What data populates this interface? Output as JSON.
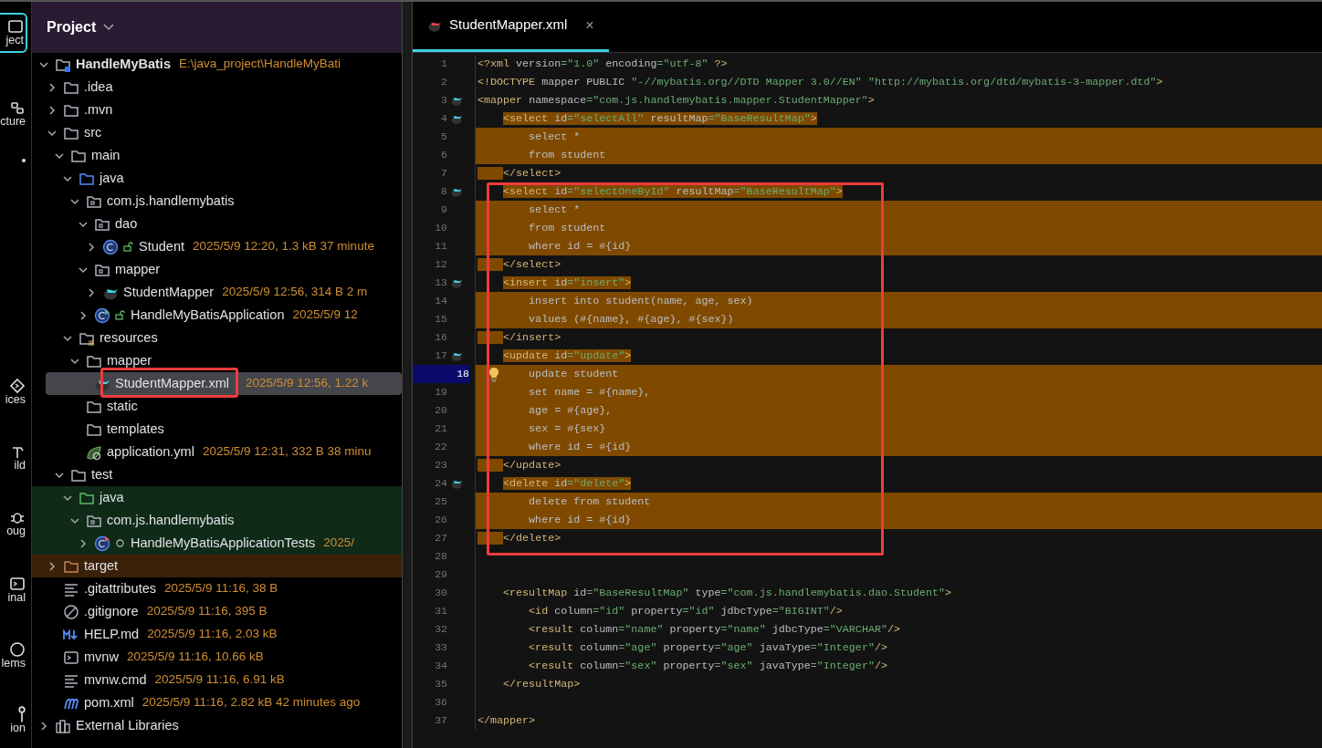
{
  "tool_strip": [
    {
      "label": "ject",
      "kind": "project",
      "selected": true
    },
    {
      "label": "cture",
      "kind": "structure",
      "selected": false
    },
    {
      "kind": "more",
      "selected": false
    },
    {
      "label": "ices",
      "kind": "services",
      "selected": false
    },
    {
      "label": "ild",
      "kind": "build",
      "selected": false
    },
    {
      "label": "oug",
      "kind": "debug",
      "selected": false
    },
    {
      "label": "inal",
      "kind": "terminal",
      "selected": false
    },
    {
      "label": "lems",
      "kind": "problems",
      "selected": false
    },
    {
      "label": "ion",
      "kind": "vcs",
      "selected": false
    }
  ],
  "project_panel": {
    "title": "Project",
    "tree": [
      {
        "name": "HandleMyBatis",
        "path": "E:\\java_project\\HandleMyBati",
        "kind": "module",
        "expanded": true,
        "selected": false,
        "children": [
          {
            "name": ".idea",
            "kind": "folder",
            "expanded": false,
            "selected": false
          },
          {
            "name": ".mvn",
            "kind": "folder",
            "expanded": false,
            "selected": false
          },
          {
            "name": "src",
            "kind": "folder",
            "expanded": true,
            "selected": false,
            "children": [
              {
                "name": "main",
                "kind": "folder",
                "expanded": true,
                "selected": false,
                "children": [
                  {
                    "name": "java",
                    "kind": "source-folder",
                    "expanded": true,
                    "selected": false,
                    "children": [
                      {
                        "name": "com.js.handlemybatis",
                        "kind": "package",
                        "expanded": true,
                        "selected": false,
                        "children": [
                          {
                            "name": "dao",
                            "kind": "package",
                            "expanded": true,
                            "selected": false,
                            "children": [
                              {
                                "name": "Student",
                                "kind": "public-class",
                                "expanded": false,
                                "selected": false,
                                "meta": "2025/5/9 12:20, 1.3 kB 37 minute"
                              }
                            ]
                          },
                          {
                            "name": "mapper",
                            "kind": "package",
                            "expanded": true,
                            "selected": false,
                            "children": [
                              {
                                "name": "StudentMapper",
                                "kind": "mybatis",
                                "expanded": false,
                                "selected": false,
                                "meta": "2025/5/9 12:56, 314 B 2 m"
                              }
                            ]
                          },
                          {
                            "name": "HandleMyBatisApplication",
                            "kind": "public-spring-class",
                            "expanded": false,
                            "selected": false,
                            "meta": "2025/5/9 12"
                          }
                        ]
                      }
                    ]
                  },
                  {
                    "name": "resources",
                    "kind": "resources",
                    "expanded": true,
                    "selected": false,
                    "children": [
                      {
                        "name": "mapper",
                        "kind": "folder",
                        "expanded": true,
                        "selected": false,
                        "children": [
                          {
                            "name": "StudentMapper.xml",
                            "kind": "mybatis",
                            "selected": true,
                            "outlined": true,
                            "meta": "2025/5/9 12:56, 1.22 k"
                          }
                        ]
                      },
                      {
                        "name": "static",
                        "kind": "folder",
                        "selected": false
                      },
                      {
                        "name": "templates",
                        "kind": "folder",
                        "selected": false
                      },
                      {
                        "name": "application.yml",
                        "kind": "spring-yml",
                        "selected": false,
                        "meta": "2025/5/9 12:31, 332 B 38 minu"
                      }
                    ]
                  }
                ]
              },
              {
                "name": "test",
                "kind": "folder",
                "expanded": true,
                "selected": false,
                "children": [
                  {
                    "name": "java",
                    "kind": "test-folder",
                    "expanded": true,
                    "selected": false,
                    "children": [
                      {
                        "name": "com.js.handlemybatis",
                        "kind": "test-package",
                        "expanded": true,
                        "selected": false,
                        "children": [
                          {
                            "name": "HandleMyBatisApplicationTests",
                            "kind": "test-class",
                            "expanded": false,
                            "selected": false,
                            "meta": "2025/"
                          }
                        ]
                      }
                    ]
                  }
                ]
              }
            ]
          },
          {
            "name": "target",
            "kind": "excluded-folder",
            "expanded": false,
            "selected": false
          },
          {
            "name": ".gitattributes",
            "kind": "text",
            "selected": false,
            "meta": "2025/5/9 11:16, 38 B"
          },
          {
            "name": ".gitignore",
            "kind": "ignore",
            "selected": false,
            "meta": "2025/5/9 11:16, 395 B"
          },
          {
            "name": "HELP.md",
            "kind": "markdown",
            "selected": false,
            "meta": "2025/5/9 11:16, 2.03 kB"
          },
          {
            "name": "mvnw",
            "kind": "shell",
            "selected": false,
            "meta": "2025/5/9 11:16, 10.66 kB"
          },
          {
            "name": "mvnw.cmd",
            "kind": "text",
            "selected": false,
            "meta": "2025/5/9 11:16, 6.91 kB"
          },
          {
            "name": "pom.xml",
            "kind": "maven",
            "selected": false,
            "meta": "2025/5/9 11:16, 2.82 kB 42 minutes ago"
          }
        ]
      },
      {
        "name": "External Libraries",
        "kind": "libraries",
        "expanded": false,
        "selected": false
      }
    ]
  },
  "editor": {
    "tabs": [
      {
        "label": "StudentMapper.xml",
        "close": "×",
        "selected": true
      }
    ],
    "lines": [
      {
        "n": "1",
        "text": "<?xml version=\"1.0\" encoding=\"utf-8\" ?>",
        "kind": "plain",
        "marker": false,
        "current": false,
        "boxed": false
      },
      {
        "n": "2",
        "text": "<!DOCTYPE mapper PUBLIC \"-//mybatis.org//DTD Mapper 3.0//EN\" \"http://mybatis.org/dtd/mybatis-3-mapper.dtd\">",
        "kind": "plain",
        "marker": false,
        "current": false,
        "boxed": false
      },
      {
        "n": "3",
        "text": "<mapper namespace=\"com.js.handlemybatis.mapper.StudentMapper\">",
        "kind": "plain",
        "marker": true,
        "current": false,
        "boxed": false
      },
      {
        "n": "4",
        "text": "    <select id=\"selectAll\" resultMap=\"BaseResultMap\">",
        "kind": "text",
        "marker": true,
        "current": false,
        "boxed": false
      },
      {
        "n": "5",
        "text": "        select *",
        "kind": "full",
        "marker": false,
        "current": false,
        "boxed": false
      },
      {
        "n": "6",
        "text": "        from student",
        "kind": "full",
        "marker": false,
        "current": false,
        "boxed": false
      },
      {
        "n": "7",
        "text": "    </select>",
        "kind": "indent",
        "marker": false,
        "current": false,
        "boxed": false
      },
      {
        "n": "8",
        "text": "    <select id=\"selectOneById\" resultMap=\"BaseResultMap\">",
        "kind": "text",
        "marker": true,
        "current": false,
        "boxed": true
      },
      {
        "n": "9",
        "text": "        select *",
        "kind": "full",
        "marker": false,
        "current": false,
        "boxed": true
      },
      {
        "n": "10",
        "text": "        from student",
        "kind": "full",
        "marker": false,
        "current": false,
        "boxed": true
      },
      {
        "n": "11",
        "text": "        where id = #{id}",
        "kind": "full",
        "marker": false,
        "current": false,
        "boxed": true
      },
      {
        "n": "12",
        "text": "    </select>",
        "kind": "indent",
        "marker": false,
        "current": false,
        "boxed": true
      },
      {
        "n": "13",
        "text": "    <insert id=\"insert\">",
        "kind": "text",
        "marker": true,
        "current": false,
        "boxed": true
      },
      {
        "n": "14",
        "text": "        insert into student(name, age, sex)",
        "kind": "full",
        "marker": false,
        "current": false,
        "boxed": true
      },
      {
        "n": "15",
        "text": "        values (#{name}, #{age}, #{sex})",
        "kind": "full",
        "marker": false,
        "current": false,
        "boxed": true
      },
      {
        "n": "16",
        "text": "    </insert>",
        "kind": "indent",
        "marker": false,
        "current": false,
        "boxed": true
      },
      {
        "n": "17",
        "text": "    <update id=\"update\">",
        "kind": "text",
        "marker": true,
        "current": false,
        "boxed": true
      },
      {
        "n": "18",
        "text": "        update student",
        "kind": "full",
        "marker": false,
        "current": true,
        "boxed": true
      },
      {
        "n": "19",
        "text": "        set name = #{name},",
        "kind": "full",
        "marker": false,
        "current": false,
        "boxed": true
      },
      {
        "n": "20",
        "text": "        age = #{age},",
        "kind": "full",
        "marker": false,
        "current": false,
        "boxed": true
      },
      {
        "n": "21",
        "text": "        sex = #{sex}",
        "kind": "full",
        "marker": false,
        "current": false,
        "boxed": true
      },
      {
        "n": "22",
        "text": "        where id = #{id}",
        "kind": "full",
        "marker": false,
        "current": false,
        "boxed": true
      },
      {
        "n": "23",
        "text": "    </update>",
        "kind": "indent",
        "marker": false,
        "current": false,
        "boxed": true
      },
      {
        "n": "24",
        "text": "    <delete id=\"delete\">",
        "kind": "text",
        "marker": true,
        "current": false,
        "boxed": true
      },
      {
        "n": "25",
        "text": "        delete from student",
        "kind": "full",
        "marker": false,
        "current": false,
        "boxed": true
      },
      {
        "n": "26",
        "text": "        where id = #{id}",
        "kind": "full",
        "marker": false,
        "current": false,
        "boxed": true
      },
      {
        "n": "27",
        "text": "    </delete>",
        "kind": "indent",
        "marker": false,
        "current": false,
        "boxed": true
      },
      {
        "n": "28",
        "kind": "plain",
        "marker": false,
        "current": false,
        "boxed": false
      },
      {
        "n": "29",
        "kind": "plain",
        "marker": false,
        "current": false,
        "boxed": false
      },
      {
        "n": "30",
        "text": "    <resultMap id=\"BaseResultMap\" type=\"com.js.handlemybatis.dao.Student\">",
        "kind": "plain",
        "marker": false,
        "current": false,
        "boxed": false
      },
      {
        "n": "31",
        "text": "        <id column=\"id\" property=\"id\" jdbcType=\"BIGINT\"/>",
        "kind": "plain",
        "marker": false,
        "current": false,
        "boxed": false
      },
      {
        "n": "32",
        "text": "        <result column=\"name\" property=\"name\" jdbcType=\"VARCHAR\"/>",
        "kind": "plain",
        "marker": false,
        "current": false,
        "boxed": false
      },
      {
        "n": "33",
        "text": "        <result column=\"age\" property=\"age\" javaType=\"Integer\"/>",
        "kind": "plain",
        "marker": false,
        "current": false,
        "boxed": false
      },
      {
        "n": "34",
        "text": "        <result column=\"sex\" property=\"sex\" javaType=\"Integer\"/>",
        "kind": "plain",
        "marker": false,
        "current": false,
        "boxed": false
      },
      {
        "n": "35",
        "text": "    </resultMap>",
        "kind": "plain",
        "marker": false,
        "current": false,
        "boxed": false
      },
      {
        "n": "36",
        "kind": "plain",
        "marker": false,
        "current": false,
        "boxed": false
      },
      {
        "n": "37",
        "text": "</mapper>",
        "kind": "plain",
        "marker": false,
        "current": false,
        "boxed": false
      }
    ]
  }
}
